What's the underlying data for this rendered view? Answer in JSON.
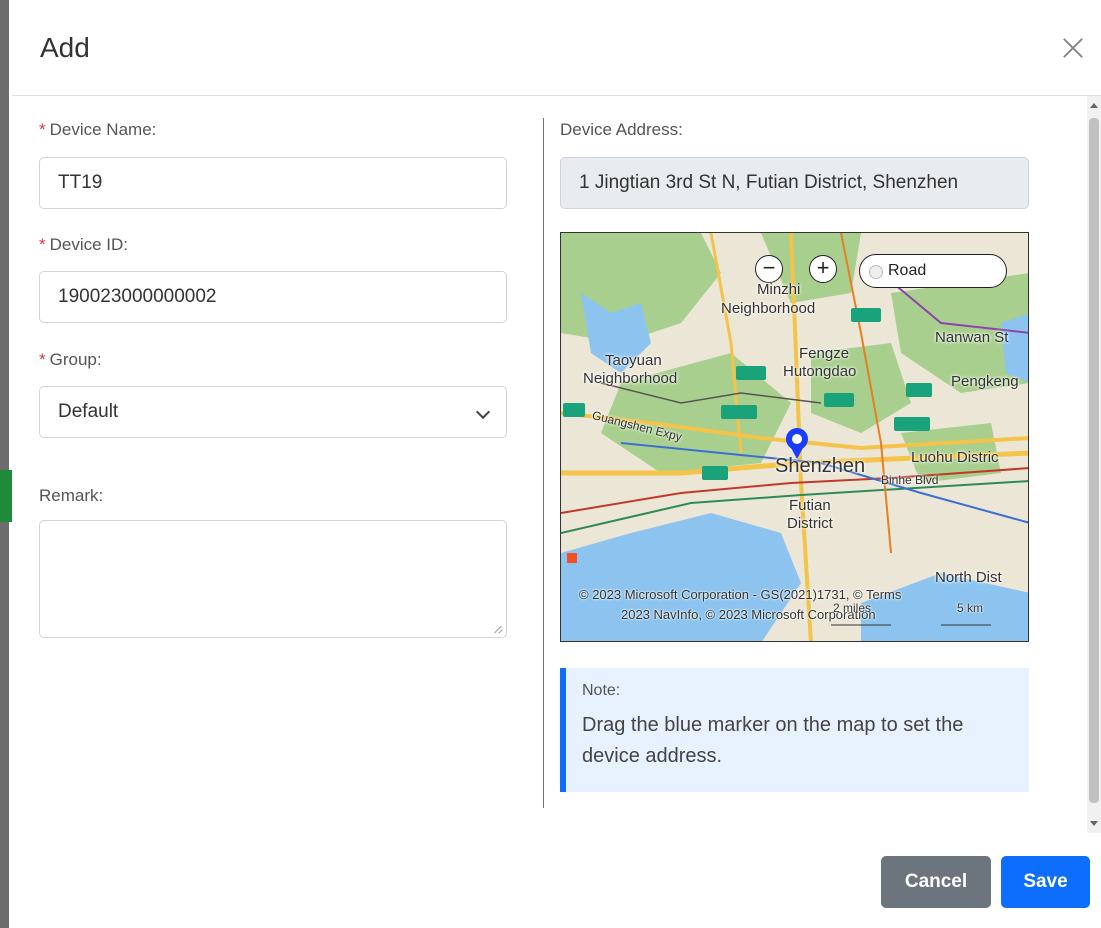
{
  "dialog": {
    "title": "Add"
  },
  "form": {
    "device_name": {
      "required_mark": "*",
      "label": "Device Name:",
      "value": "TT19"
    },
    "device_id": {
      "required_mark": "*",
      "label": "Device ID:",
      "value": "190023000000002"
    },
    "group": {
      "required_mark": "*",
      "label": "Group:",
      "value": "Default"
    },
    "remark": {
      "label": "Remark:",
      "value": ""
    }
  },
  "address": {
    "label": "Device Address:",
    "value": "1 Jingtian 3rd St N, Futian District, Shenzhen"
  },
  "map": {
    "zoom_out_symbol": "−",
    "zoom_in_symbol": "+",
    "style_label": "Road",
    "places": {
      "minzhi": "Minzhi",
      "neighborhood1": "Neighborhood",
      "nanwan": "Nanwan St",
      "fengze": "Fengze",
      "taoyuan": "Taoyuan",
      "neighborhood2": "Neighborhood",
      "hutongdao": "Hutongdao",
      "pengkeng": "Pengkeng",
      "guangshen": "Guangshen Expy",
      "shenzhen": "Shenzhen",
      "luohu": "Luohu Distric",
      "futian": "Futian",
      "district": "District",
      "binhe": "Binhe Blvd",
      "north_dist": "North Dist"
    },
    "copyright_line1": "© 2023 Microsoft Corporation - GS(2021)1731, © Terms",
    "copyright_line2": "2023 NavInfo, © 2023 Microsoft Corporation",
    "scale_miles": "2 miles",
    "scale_km": "5 km",
    "colors": {
      "water": "#8cc4ef",
      "park": "#a9cf8e",
      "urban": "#ece6d6",
      "road_major": "#f3c34a",
      "marker": "#1a3cff"
    }
  },
  "note": {
    "label": "Note:",
    "text": "Drag the blue marker on the map to set the device address."
  },
  "footer": {
    "cancel_label": "Cancel",
    "save_label": "Save"
  }
}
